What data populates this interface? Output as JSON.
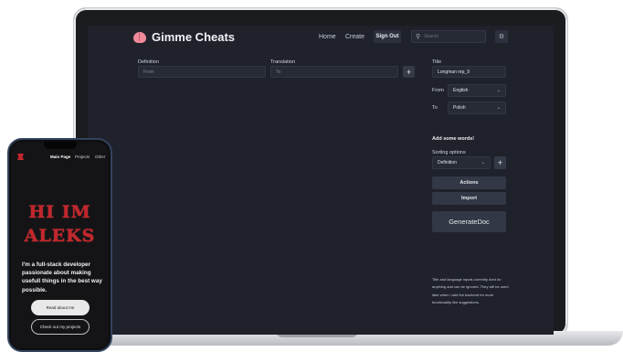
{
  "laptop": {
    "header": {
      "brand": "Gimme Cheats",
      "nav": [
        "Home",
        "Create"
      ],
      "sign_out": "Sign Out",
      "search_placeholder": "Search"
    },
    "form": {
      "definition_label": "Definition",
      "definition_placeholder": "From",
      "translation_label": "Translation",
      "translation_placeholder": "To",
      "add_symbol": "+"
    },
    "sidebar": {
      "title_label": "Title",
      "title_value": "Longman rep_9",
      "from_label": "From",
      "from_value": "English",
      "to_label": "To",
      "to_value": "Polish",
      "add_words": "Add some words!",
      "sorting_label": "Sorting options",
      "sorting_value": "Definition",
      "actions": "Actions",
      "import": "Import",
      "generate": "GenerateDoc",
      "note": "Title and language inputs currently dont do anything and can be ignored. They will be used later when i add the backend for more functionality like suggestions."
    }
  },
  "phone": {
    "nav": [
      "Main Page",
      "Projects",
      "Other"
    ],
    "hero_line1": "HI IM",
    "hero_line2": "ALEKS",
    "intro": "I'm a full-stack developer passionate about making usefull things in the best way possible.",
    "read_about": "Read about me",
    "check_projects": "Check out my projects"
  },
  "colors": {
    "app_bg": "#1f222b",
    "accent_red": "#c2272d",
    "button_bg": "#323846"
  }
}
